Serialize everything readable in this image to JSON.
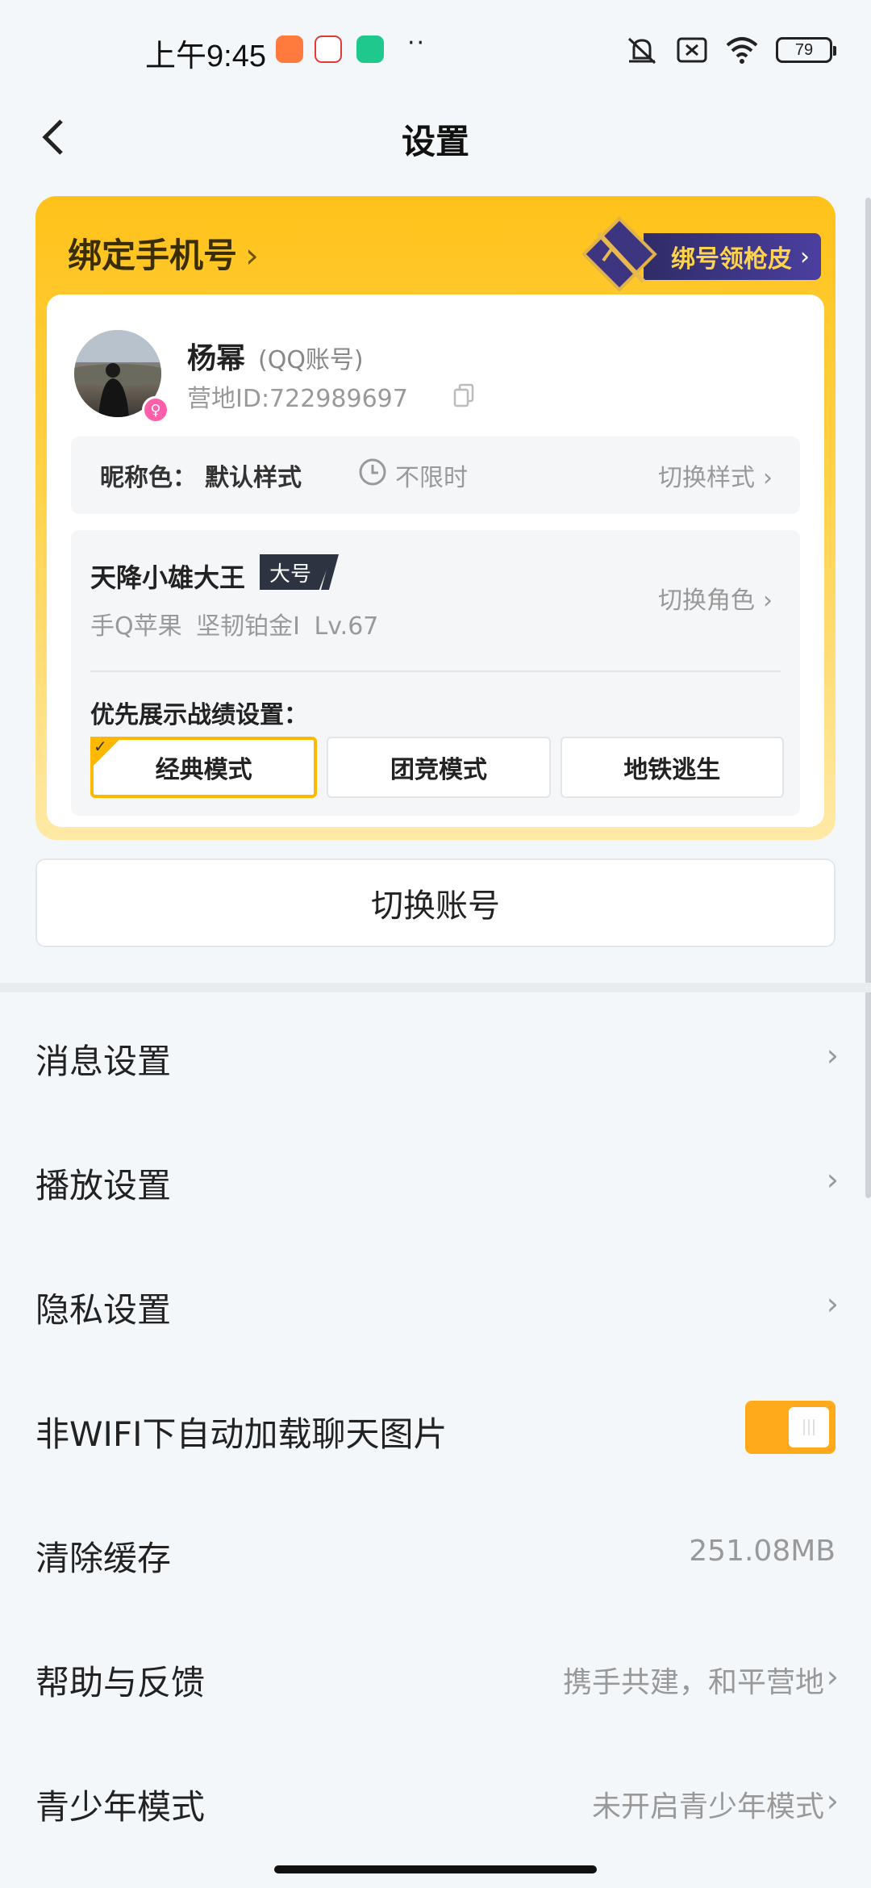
{
  "status_bar": {
    "time": "上午9:45",
    "battery": "79",
    "dots": "··",
    "icons": [
      "shopping-app-icon",
      "news-app-icon",
      "security-app-icon",
      "mute-icon",
      "no-sim-icon",
      "wifi-icon",
      "battery-icon"
    ]
  },
  "header": {
    "title": "设置"
  },
  "promo": {
    "bind_phone": "绑定手机号",
    "badge": "绑号领枪皮"
  },
  "profile": {
    "name": "杨幂",
    "account_type": "(QQ账号)",
    "camp_id": "营地ID:722989697"
  },
  "nickname": {
    "label": "昵称色：",
    "value": "默认样式",
    "duration": "不限时",
    "switch": "切换样式"
  },
  "role": {
    "name": "天降小雄大王",
    "tag": "大号",
    "sub": "手Q苹果  坚韧铂金I  Lv.67",
    "switch": "切换角色",
    "priority_label": "优先展示战绩设置：",
    "modes": [
      "经典模式",
      "团竞模式",
      "地铁逃生"
    ],
    "selected_mode": "经典模式"
  },
  "switch_account": "切换账号",
  "settings": {
    "message": "消息设置",
    "playback": "播放设置",
    "privacy": "隐私设置",
    "auto_load_images": "非WIFI下自动加载聊天图片",
    "auto_load_images_on": true,
    "clear_cache": "清除缓存",
    "cache_size": "251.08MB",
    "help_feedback": "帮助与反馈",
    "help_feedback_value": "携手共建，和平营地",
    "youth_mode": "青少年模式",
    "youth_mode_value": "未开启青少年模式"
  },
  "colors": {
    "accent": "#ffb800",
    "toggle": "#ffaa1a",
    "promo_badge": "#3d357f",
    "gender_badge": "#ff5fa8"
  }
}
